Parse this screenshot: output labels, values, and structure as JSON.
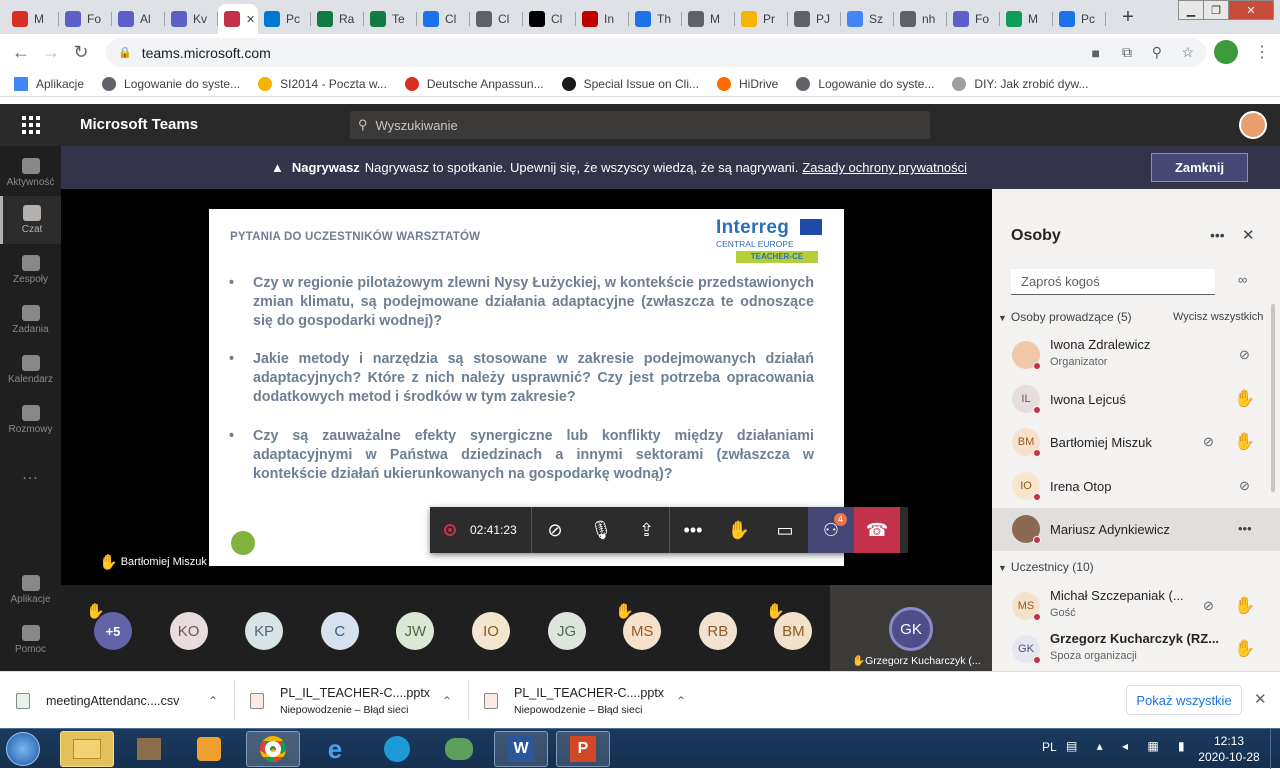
{
  "browser": {
    "tabs": [
      {
        "label": "M",
        "color": "#d93025"
      },
      {
        "label": "Fo",
        "color": "#5b5fc7"
      },
      {
        "label": "Al",
        "color": "#5b5fc7"
      },
      {
        "label": "Kv",
        "color": "#5b5fc7"
      },
      {
        "label": "",
        "color": "#c4314b",
        "active": true
      },
      {
        "label": "Pc",
        "color": "#0078d4"
      },
      {
        "label": "Ra",
        "color": "#107c41"
      },
      {
        "label": "Te",
        "color": "#107c41"
      },
      {
        "label": "Cl",
        "color": "#1a73e8"
      },
      {
        "label": "Cl",
        "color": "#5f6368"
      },
      {
        "label": "Cl",
        "color": "#000000"
      },
      {
        "label": "In",
        "color": "#c00000"
      },
      {
        "label": "Th",
        "color": "#1a73e8"
      },
      {
        "label": "M",
        "color": "#5f6368"
      },
      {
        "label": "Pr",
        "color": "#f4b400"
      },
      {
        "label": "PJ",
        "color": "#5f6368"
      },
      {
        "label": "Sz",
        "color": "#4285f4"
      },
      {
        "label": "nh",
        "color": "#5f6368"
      },
      {
        "label": "Fo",
        "color": "#5b5fc7"
      },
      {
        "label": "M",
        "color": "#0f9d58"
      },
      {
        "label": "Pc",
        "color": "#1a73e8"
      }
    ],
    "url": "teams.microsoft.com",
    "bookmarks": [
      {
        "label": "Aplikacje",
        "color": "#4285f4"
      },
      {
        "label": "Logowanie do syste...",
        "color": "#5f6368"
      },
      {
        "label": "SI2014 - Poczta w...",
        "color": "#f4b400"
      },
      {
        "label": "Deutsche Anpassun...",
        "color": "#d93025"
      },
      {
        "label": "Special Issue on Cli...",
        "color": "#1a1a1a"
      },
      {
        "label": "HiDrive",
        "color": "#ff6d00"
      },
      {
        "label": "Logowanie do syste...",
        "color": "#5f6368"
      },
      {
        "label": "DIY: Jak zrobić dyw...",
        "color": "#9e9e9e"
      }
    ]
  },
  "teams": {
    "app_title": "Microsoft Teams",
    "search_placeholder": "Wyszukiwanie",
    "rail": [
      {
        "label": "Aktywność"
      },
      {
        "label": "Czat"
      },
      {
        "label": "Zespoły"
      },
      {
        "label": "Zadania"
      },
      {
        "label": "Kalendarz"
      },
      {
        "label": "Rozmowy"
      },
      {
        "label": "..."
      },
      {
        "label": "Aplikacje"
      },
      {
        "label": "Pomoc"
      }
    ],
    "banner": {
      "bold": "Nagrywasz",
      "text": "Nagrywasz to spotkanie. Upewnij się, że wszyscy wiedzą, że są nagrywani.",
      "link": "Zasady ochrony prywatności",
      "close": "Zamknij"
    },
    "slide": {
      "title": "PYTANIA DO UCZESTNIKÓW WARSZTATÓW",
      "logo_line1": "Interreg",
      "logo_line2": "CENTRAL EUROPE",
      "logo_line3": "TEACHER-CE",
      "bullet": "•",
      "questions": [
        "Czy w regionie pilotażowym zlewni Nysy Łużyckiej, w kontekście przedstawionych zmian klimatu, są podejmowane działania adaptacyjne (zwłaszcza te odnoszące się do gospodarki wodnej)?",
        "Jakie metody i narzędzia są stosowane w zakresie podejmowanych działań adaptacyjnych? Które z nich należy usprawnić? Czy jest potrzeba opracowania dodatkowych metod i środków w tym zakresie?",
        "Czy są zauważalne efekty synergiczne lub konflikty między działaniami adaptacyjnymi w Państwa dziedzinach a innymi sektorami (zwłaszcza w kontekście działań ukierunkowanych na gospodarkę wodną)?"
      ]
    },
    "presenter_label": "Bartłomiej Miszuk",
    "call_timer": "02:41:23",
    "participants_badge": "4",
    "strip": [
      {
        "initials": "+5",
        "bg": "#6264a7",
        "fg": "#ffffff",
        "hand": true
      },
      {
        "initials": "KO",
        "bg": "#e8dcdc",
        "fg": "#6b5555",
        "hand": false
      },
      {
        "initials": "KP",
        "bg": "#d7e3e6",
        "fg": "#4e6a70",
        "hand": false
      },
      {
        "initials": "C",
        "bg": "#d5e1ee",
        "fg": "#405a7a",
        "hand": false
      },
      {
        "initials": "JW",
        "bg": "#dbe8d6",
        "fg": "#4d6b43",
        "hand": false
      },
      {
        "initials": "IO",
        "bg": "#f3e6cf",
        "fg": "#8a5a1a",
        "hand": false
      },
      {
        "initials": "JG",
        "bg": "#dde5dd",
        "fg": "#4f6a4f",
        "hand": false
      },
      {
        "initials": "MS",
        "bg": "#f5e1cc",
        "fg": "#9a5a22",
        "hand": true
      },
      {
        "initials": "RB",
        "bg": "#f2e3d1",
        "fg": "#8b5d2a",
        "hand": false
      },
      {
        "initials": "BM",
        "bg": "#f2e2cc",
        "fg": "#8d5b1e",
        "hand": true
      }
    ],
    "speaker_tile": {
      "initials": "GK",
      "name": "Grzegorz Kucharczyk (..."
    },
    "panel": {
      "title": "Osoby",
      "invite_placeholder": "Zaproś kogoś",
      "presenters_header": "Osoby prowadzące (5)",
      "mute_all": "Wycisz wszystkich",
      "presenters": [
        {
          "name": "Iwona Zdralewicz",
          "sub": "Organizator",
          "initials": "",
          "bg": "#f0c8a8",
          "fg": "#7a4a20",
          "hand": false,
          "muted": true
        },
        {
          "name": "Iwona Lejcuś",
          "sub": "",
          "initials": "IL",
          "bg": "#e6dede",
          "fg": "#6b5555",
          "hand": true,
          "muted": false
        },
        {
          "name": "Bartłomiej Miszuk",
          "sub": "",
          "initials": "BM",
          "bg": "#f5e1cc",
          "fg": "#9a5a22",
          "hand": true,
          "muted": true
        },
        {
          "name": "Irena Otop",
          "sub": "",
          "initials": "IO",
          "bg": "#f5e6cc",
          "fg": "#8a5a1a",
          "hand": false,
          "muted": true
        },
        {
          "name": "Mariusz Adynkiewicz",
          "sub": "",
          "initials": "",
          "bg": "#8c6a52",
          "fg": "#ffffff",
          "hand": false,
          "muted": false
        }
      ],
      "attendees_header": "Uczestnicy (10)",
      "attendees": [
        {
          "name": "Michał Szczepaniak (...",
          "sub": "Gość",
          "initials": "MS",
          "bg": "#f5e1cc",
          "fg": "#9a5a22",
          "hand": true,
          "muted": true
        },
        {
          "name": "Grzegorz Kucharczyk (RZ...",
          "sub": "Spoza organizacji",
          "initials": "GK",
          "bg": "#e6e6f0",
          "fg": "#505070",
          "hand": true,
          "muted": false
        }
      ]
    }
  },
  "downloads": {
    "items": [
      {
        "name": "meetingAttendanc....csv",
        "status": ""
      },
      {
        "name": "PL_IL_TEACHER-C....pptx",
        "status": "Niepowodzenie – Błąd sieci"
      },
      {
        "name": "PL_IL_TEACHER-C....pptx",
        "status": "Niepowodzenie – Błąd sieci"
      }
    ],
    "show_all": "Pokaż wszystkie"
  },
  "taskbar": {
    "lang": "PL",
    "time": "12:13",
    "date": "2020-10-28"
  }
}
